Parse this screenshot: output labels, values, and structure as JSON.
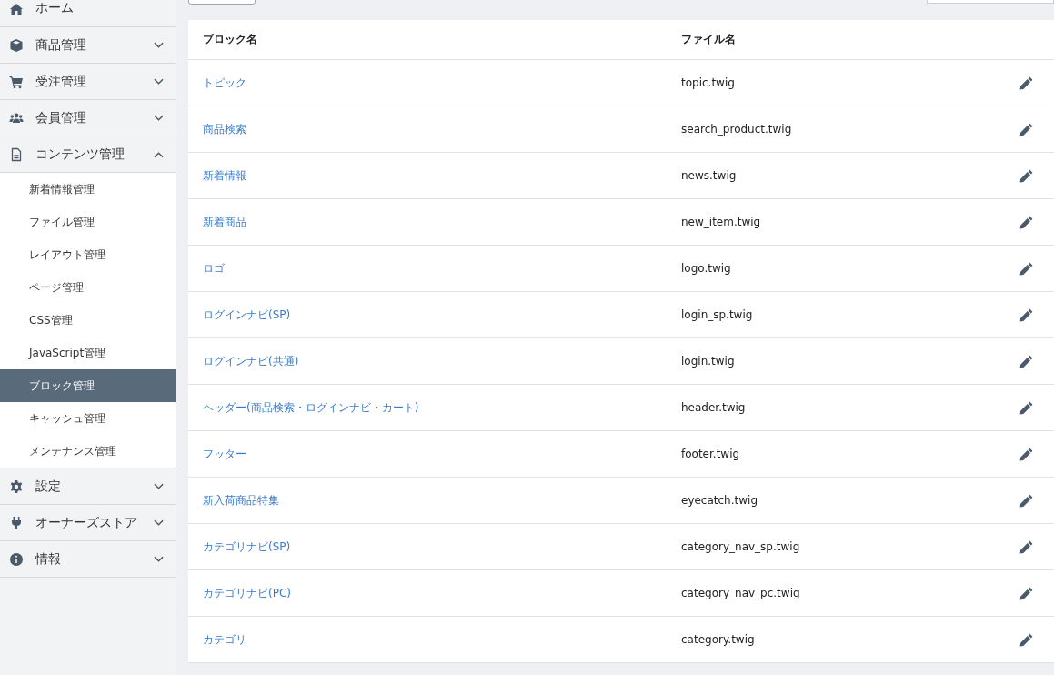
{
  "sidebar": {
    "items": [
      {
        "label": "ホーム",
        "kind": "link"
      },
      {
        "label": "商品管理",
        "kind": "group",
        "expanded": false
      },
      {
        "label": "受注管理",
        "kind": "group",
        "expanded": false
      },
      {
        "label": "会員管理",
        "kind": "group",
        "expanded": false
      },
      {
        "label": "コンテンツ管理",
        "kind": "group",
        "expanded": true,
        "children": [
          {
            "label": "新着情報管理",
            "selected": false
          },
          {
            "label": "ファイル管理",
            "selected": false
          },
          {
            "label": "レイアウト管理",
            "selected": false
          },
          {
            "label": "ページ管理",
            "selected": false
          },
          {
            "label": "CSS管理",
            "selected": false
          },
          {
            "label": "JavaScript管理",
            "selected": false
          },
          {
            "label": "ブロック管理",
            "selected": true
          },
          {
            "label": "キャッシュ管理",
            "selected": false
          },
          {
            "label": "メンテナンス管理",
            "selected": false
          }
        ]
      },
      {
        "label": "設定",
        "kind": "group",
        "expanded": false
      },
      {
        "label": "オーナーズストア",
        "kind": "group",
        "expanded": false
      },
      {
        "label": "情報",
        "kind": "group",
        "expanded": false
      }
    ]
  },
  "table": {
    "columns": [
      "ブロック名",
      "ファイル名"
    ],
    "rows": [
      {
        "name": "トピック",
        "file": "topic.twig"
      },
      {
        "name": "商品検索",
        "file": "search_product.twig"
      },
      {
        "name": "新着情報",
        "file": "news.twig"
      },
      {
        "name": "新着商品",
        "file": "new_item.twig"
      },
      {
        "name": "ロゴ",
        "file": "logo.twig"
      },
      {
        "name": "ログインナビ(SP)",
        "file": "login_sp.twig"
      },
      {
        "name": "ログインナビ(共通)",
        "file": "login.twig"
      },
      {
        "name": "ヘッダー(商品検索・ログインナビ・カート)",
        "file": "header.twig"
      },
      {
        "name": "フッター",
        "file": "footer.twig"
      },
      {
        "name": "新入荷商品特集",
        "file": "eyecatch.twig"
      },
      {
        "name": "カテゴリナビ(SP)",
        "file": "category_nav_sp.twig"
      },
      {
        "name": "カテゴリナビ(PC)",
        "file": "category_nav_pc.twig"
      },
      {
        "name": "カテゴリ",
        "file": "category.twig"
      }
    ]
  }
}
